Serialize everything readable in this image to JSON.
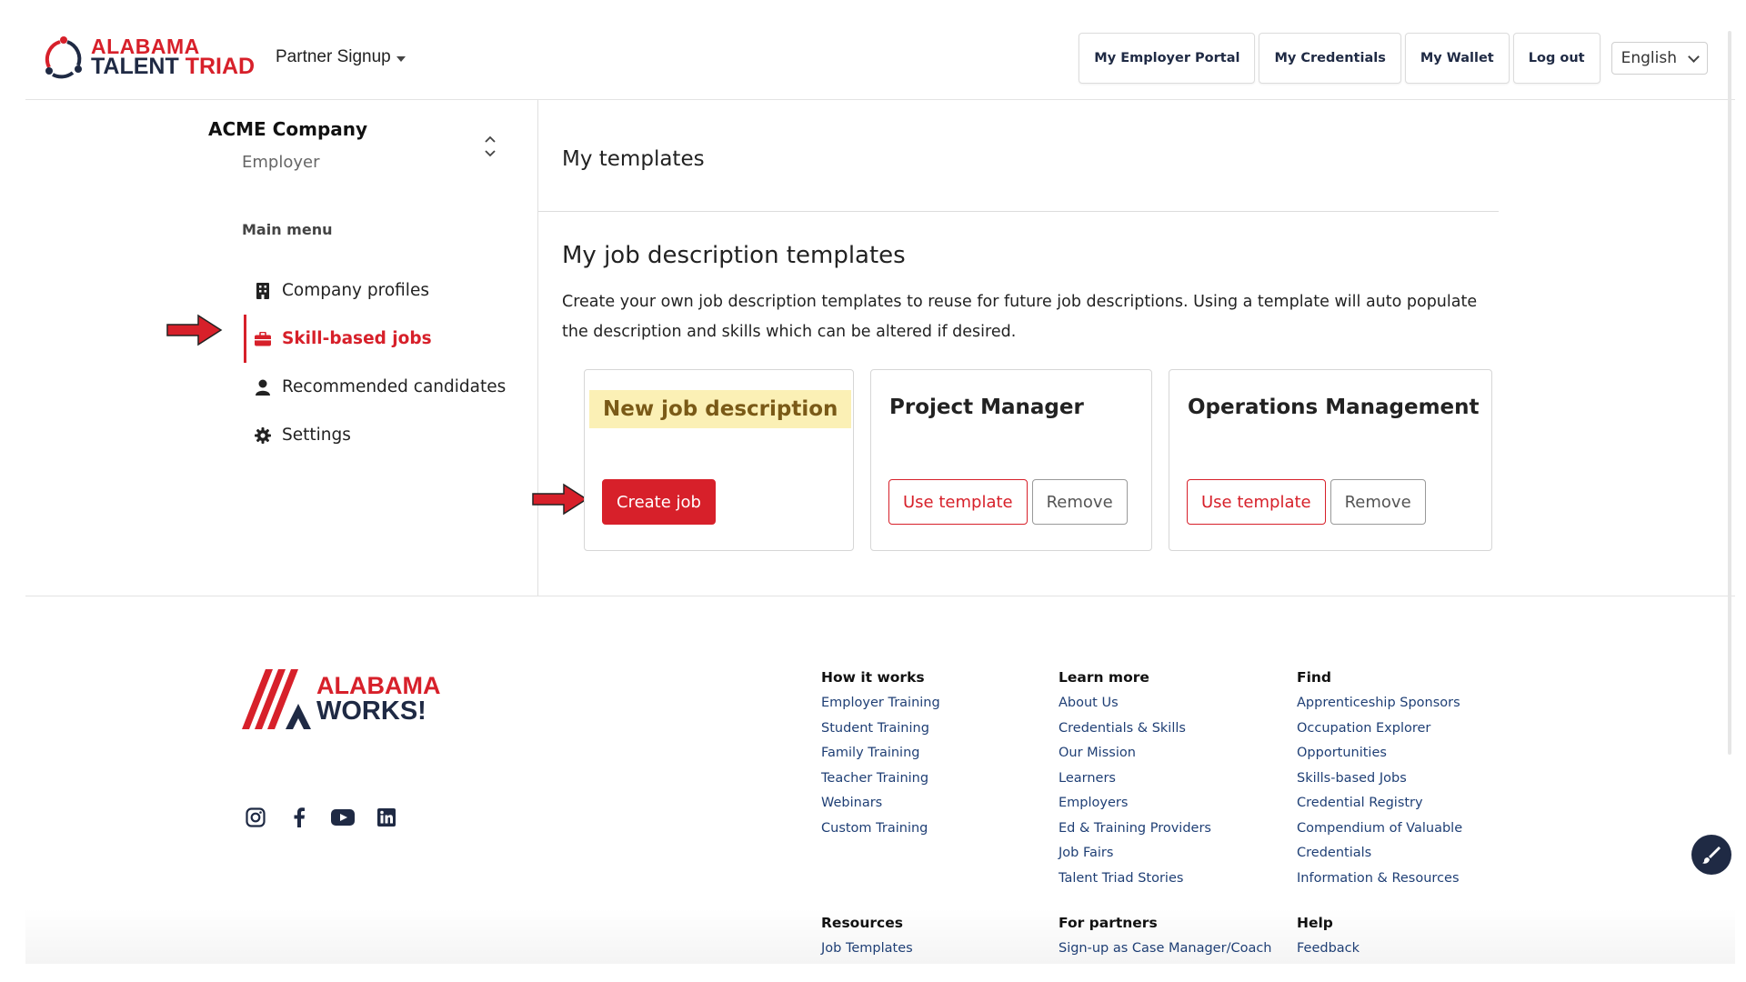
{
  "header": {
    "logo": {
      "line1": "ALABAMA",
      "line2a": "TALENT",
      "line2b": "TRIAD"
    },
    "partner_signup": "Partner Signup",
    "nav": [
      {
        "label": "My Employer Portal"
      },
      {
        "label": "My Credentials"
      },
      {
        "label": "My Wallet"
      },
      {
        "label": "Log out"
      }
    ],
    "language": "English"
  },
  "sidebar": {
    "company": "ACME Company",
    "role": "Employer",
    "menu_title": "Main menu",
    "items": [
      {
        "label": "Company profiles",
        "icon": "building-icon"
      },
      {
        "label": "Skill-based jobs",
        "icon": "briefcase-icon",
        "active": true
      },
      {
        "label": "Recommended candidates",
        "icon": "person-icon"
      },
      {
        "label": "Settings",
        "icon": "gear-icon"
      }
    ]
  },
  "main": {
    "title": "My templates",
    "section_title": "My job description templates",
    "description": "Create your own job description templates to reuse for future job descriptions. Using a template will auto populate the description and skills which can be altered if desired.",
    "cards": [
      {
        "title": "New job description",
        "primary": "Create job"
      },
      {
        "title": "Project Manager",
        "use": "Use template",
        "remove": "Remove"
      },
      {
        "title": "Operations Management",
        "use": "Use template",
        "remove": "Remove"
      }
    ]
  },
  "footer": {
    "logo": {
      "line1": "ALABAMA",
      "line2": "WORKS!"
    },
    "social": [
      "instagram-icon",
      "facebook-icon",
      "youtube-icon",
      "linkedin-icon"
    ],
    "columns": [
      {
        "title": "How it works",
        "links": [
          "Employer Training",
          "Student Training",
          "Family Training",
          "Teacher Training",
          "Webinars",
          "Custom Training"
        ]
      },
      {
        "title": "Learn more",
        "links": [
          "About Us",
          "Credentials & Skills",
          "Our Mission",
          "Learners",
          "Employers",
          "Ed & Training Providers",
          "Job Fairs",
          "Talent Triad Stories"
        ]
      },
      {
        "title": "Find",
        "links": [
          "Apprenticeship Sponsors",
          "Occupation Explorer",
          "Opportunities",
          "Skills-based Jobs",
          "Credential Registry",
          "Compendium of Valuable",
          "Credentials",
          "Information & Resources"
        ]
      },
      {
        "title": "Resources",
        "links": [
          "Job Templates"
        ]
      },
      {
        "title": "For partners",
        "links": [
          "Sign-up as Case Manager/Coach"
        ]
      },
      {
        "title": "Help",
        "links": [
          "Feedback"
        ]
      }
    ]
  },
  "colors": {
    "accent": "#d7202a",
    "navy": "#1f2a44",
    "highlight": "#fbf0b5",
    "link": "#1f3f75"
  }
}
